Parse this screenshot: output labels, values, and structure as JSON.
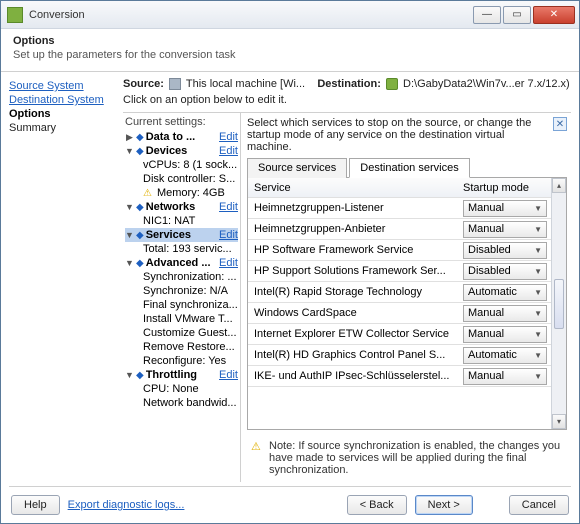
{
  "window": {
    "title": "Conversion"
  },
  "header": {
    "title": "Options",
    "subtitle": "Set up the parameters for the conversion task"
  },
  "nav": {
    "source_system": "Source System",
    "destination_system": "Destination System",
    "options": "Options",
    "summary": "Summary"
  },
  "srcdest": {
    "source_label": "Source:",
    "source_value": "This local machine [Wi...",
    "dest_label": "Destination:",
    "dest_value": "D:\\GabyData2\\Win7v...er 7.x/12.x)"
  },
  "hint": "Click on an option below to edit it.",
  "tree": {
    "header": "Current settings:",
    "edit": "Edit",
    "items": {
      "data": "Data to ...",
      "devices": "Devices",
      "devices_sub1": "vCPUs: 8 (1 sock...",
      "devices_sub2": "Disk controller: S...",
      "devices_sub3": "Memory: 4GB",
      "networks": "Networks",
      "networks_sub1": "NIC1: NAT",
      "services": "Services",
      "services_sub1": "Total: 193 servic...",
      "advanced": "Advanced ...",
      "adv_sub1": "Synchronization: ...",
      "adv_sub2": "Synchronize: N/A",
      "adv_sub3": "Final synchroniza...",
      "adv_sub4": "Install VMware T...",
      "adv_sub5": "Customize Guest...",
      "adv_sub6": "Remove Restore...",
      "adv_sub7": "Reconfigure: Yes",
      "throttling": "Throttling",
      "thr_sub1": "CPU: None",
      "thr_sub2": "Network bandwid..."
    }
  },
  "panel": {
    "desc": "Select which services to stop on the source, or change the startup mode of any service on the destination virtual machine.",
    "tabs": {
      "source": "Source services",
      "dest": "Destination services"
    },
    "columns": {
      "service": "Service",
      "mode": "Startup mode"
    },
    "rows": [
      {
        "name": "Heimnetzgruppen-Listener",
        "mode": "Manual"
      },
      {
        "name": "Heimnetzgruppen-Anbieter",
        "mode": "Manual"
      },
      {
        "name": "HP Software Framework Service",
        "mode": "Disabled"
      },
      {
        "name": "HP Support Solutions Framework Ser...",
        "mode": "Disabled"
      },
      {
        "name": "Intel(R) Rapid Storage Technology",
        "mode": "Automatic"
      },
      {
        "name": "Windows CardSpace",
        "mode": "Manual"
      },
      {
        "name": "Internet Explorer ETW Collector Service",
        "mode": "Manual"
      },
      {
        "name": "Intel(R) HD Graphics Control Panel S...",
        "mode": "Automatic"
      },
      {
        "name": "IKE- und AuthIP IPsec-Schlüsselerstel...",
        "mode": "Manual"
      }
    ],
    "note": "Note: If source synchronization is enabled, the changes you have made to services will be applied during the final synchronization."
  },
  "footer": {
    "help": "Help",
    "export": "Export diagnostic logs...",
    "back": "< Back",
    "next": "Next >",
    "cancel": "Cancel"
  }
}
